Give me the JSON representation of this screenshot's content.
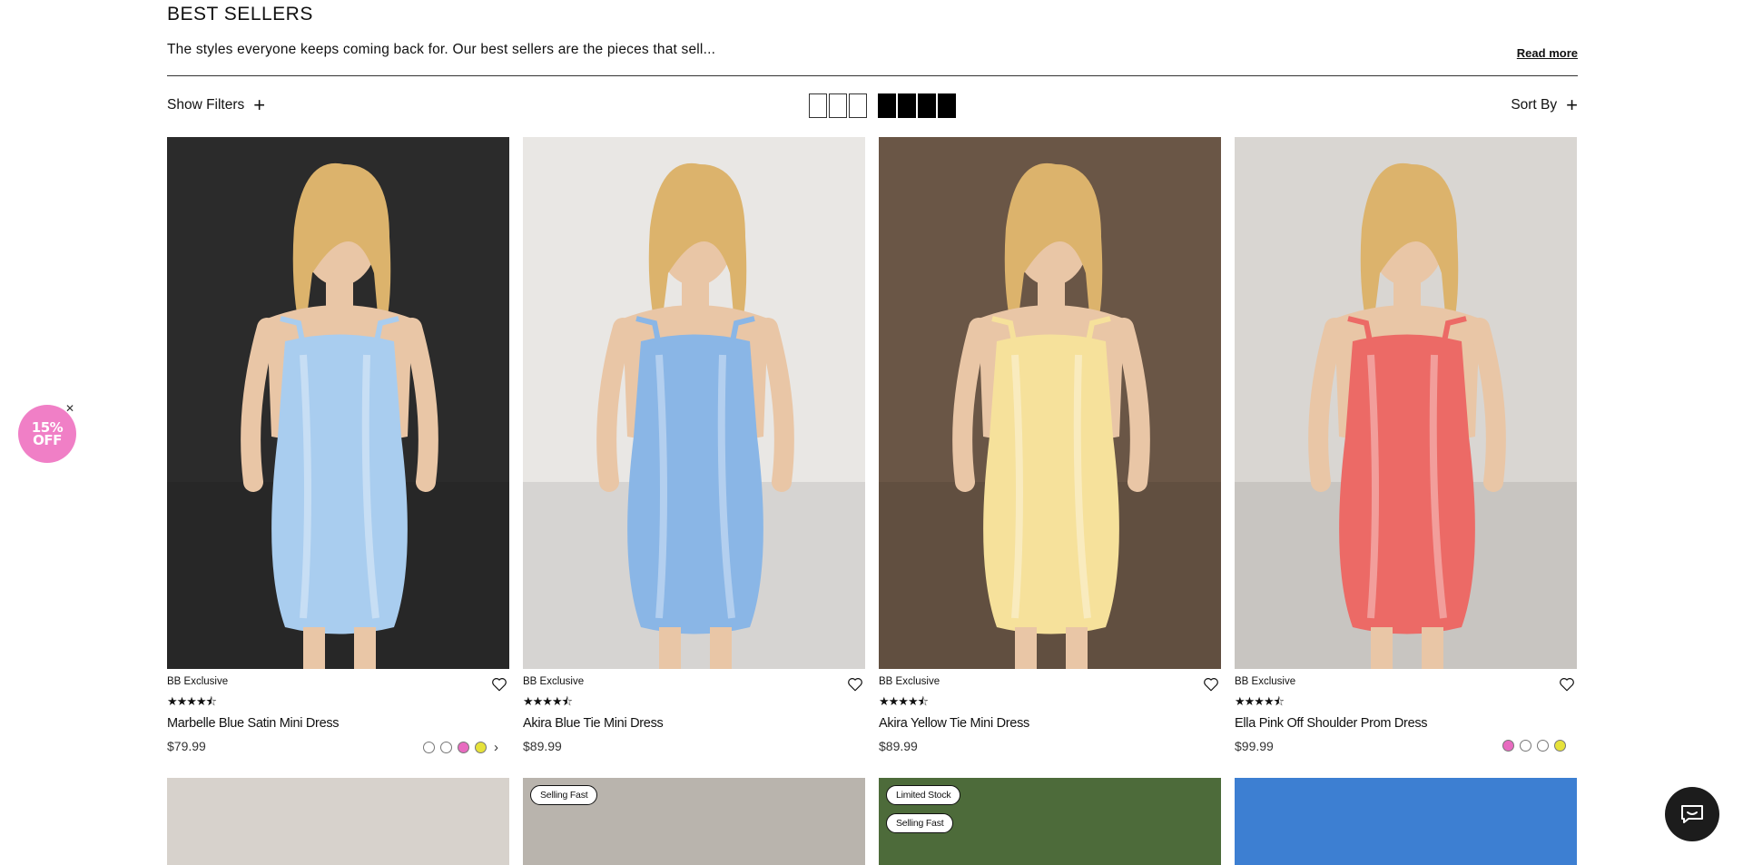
{
  "header": {
    "title": "BEST SELLERS",
    "intro": "The styles everyone keeps coming back for. Our best sellers are the pieces that sell...",
    "read_more": "Read more"
  },
  "toolbar": {
    "show_filters": "Show Filters",
    "sort_by": "Sort By",
    "grid_options": [
      "3-column",
      "4-column"
    ],
    "active_grid": "4-column"
  },
  "products": [
    {
      "brand": "BB Exclusive",
      "rating": 4.5,
      "stars": "★★★★⯪",
      "name": "Marbelle Blue Satin Mini Dress",
      "price": "$79.99",
      "swatches": [
        "#ffffff",
        "#ffffff",
        "#e86bc0",
        "#e6e23a"
      ],
      "photo_bg": "#2b2b2b",
      "dress_color": "#a9cdef"
    },
    {
      "brand": "BB Exclusive",
      "rating": 4.5,
      "stars": "★★★★⯪",
      "name": "Akira Blue Tie Mini Dress",
      "price": "$89.99",
      "swatches": [],
      "photo_bg": "#e9e7e4",
      "dress_color": "#8ab6e6"
    },
    {
      "brand": "BB Exclusive",
      "rating": 4.5,
      "stars": "★★★★⯪",
      "name": "Akira Yellow Tie Mini Dress",
      "price": "$89.99",
      "swatches": [],
      "photo_bg": "#6a5646",
      "dress_color": "#f6e19b"
    },
    {
      "brand": "BB Exclusive",
      "rating": 4.5,
      "stars": "★★★★⯪",
      "name": "Ella Pink Off Shoulder Prom Dress",
      "price": "$99.99",
      "swatches": [
        "#e86bc0",
        "#ffffff",
        "#ffffff",
        "#e6e23a"
      ],
      "photo_bg": "#d9d6d2",
      "dress_color": "#ec6a66"
    }
  ],
  "row2": [
    {
      "badges": [],
      "photo_bg": "#d7d2cc"
    },
    {
      "badges": [
        "Selling Fast"
      ],
      "photo_bg": "#b9b4ad"
    },
    {
      "badges": [
        "Limited Stock",
        "Selling Fast"
      ],
      "photo_bg": "#4d6b3a"
    },
    {
      "badges": [],
      "photo_bg": "#3d7fd2"
    }
  ],
  "promo": {
    "line1": "15%",
    "line2": "OFF",
    "color": "#f07fc6"
  },
  "icons": {
    "heart": "heart-icon",
    "plus": "plus-icon",
    "chat": "chat-icon",
    "close": "close-icon",
    "chevron": "chevron-right-icon"
  }
}
